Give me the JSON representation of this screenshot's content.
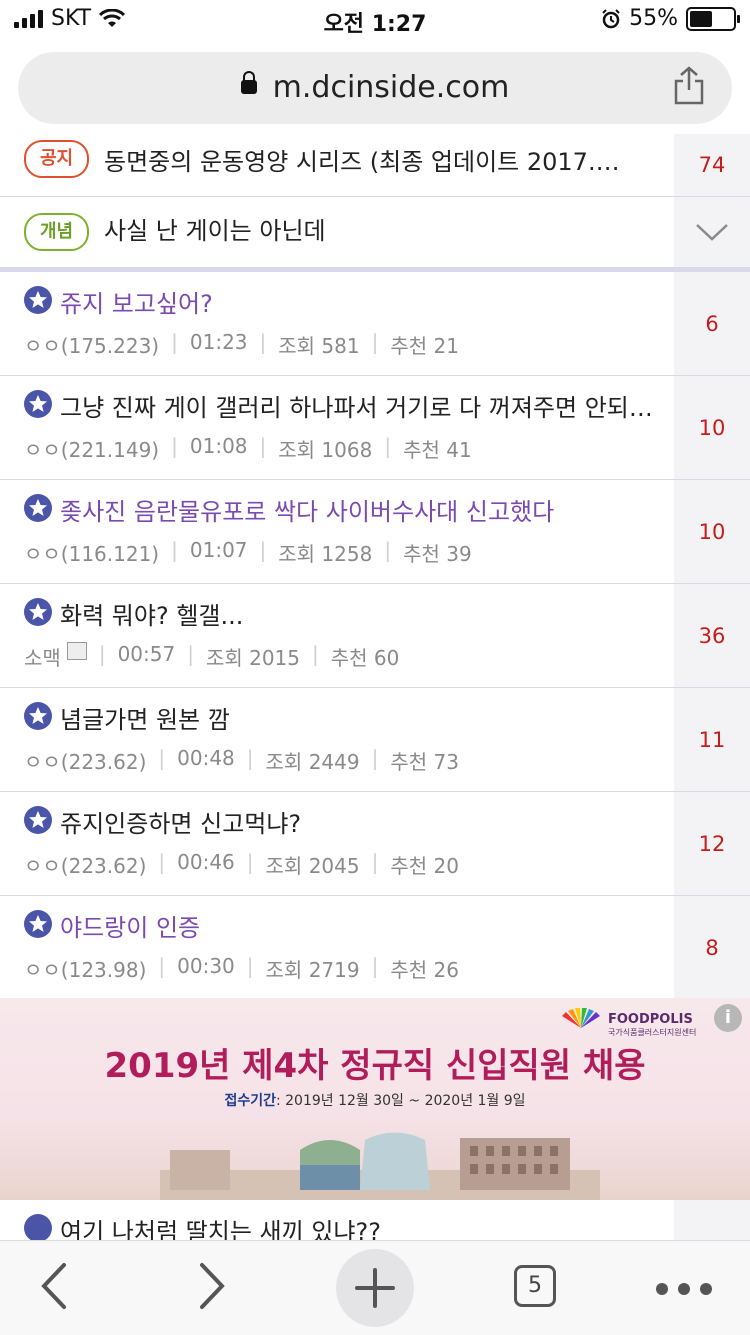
{
  "status_bar": {
    "carrier": "SKT",
    "time": "오전 1:27",
    "battery_pct": "55%",
    "battery_level": 0.55
  },
  "browser": {
    "url": "m.dcinside.com"
  },
  "pinned": [
    {
      "tag": "공지",
      "tag_color": "#e05030",
      "title": "동면중의 운동영양 시리즈 (최종 업데이트 2017.…",
      "count": "74"
    },
    {
      "tag": "개념",
      "tag_color": "#6d9e25",
      "title": "사실 난 게이는 아닌데"
    }
  ],
  "posts": [
    {
      "title": "쥬지 보고싶어?",
      "visited": true,
      "author": "ㅇㅇ(175.223)",
      "time": "01:23",
      "views": "조회 581",
      "recommend": "추천 21",
      "count": "6"
    },
    {
      "title": "그냥 진짜 게이 갤러리 하나파서 거기로 다 꺼져주면 안되…",
      "visited": false,
      "author": "ㅇㅇ(221.149)",
      "time": "01:08",
      "views": "조회 1068",
      "recommend": "추천 41",
      "count": "10"
    },
    {
      "title": "좆사진 음란물유포로 싹다 사이버수사대 신고했다",
      "visited": true,
      "author": "ㅇㅇ(116.121)",
      "time": "01:07",
      "views": "조회 1258",
      "recommend": "추천 39",
      "count": "10"
    },
    {
      "title": "화력 뭐야? 헬갤...",
      "visited": false,
      "author": "소맥",
      "time": "00:57",
      "views": "조회 2015",
      "recommend": "추천 60",
      "count": "36"
    },
    {
      "title": "념글가면 원본 깜",
      "visited": false,
      "author": "ㅇㅇ(223.62)",
      "time": "00:48",
      "views": "조회 2449",
      "recommend": "추천 73",
      "count": "11"
    },
    {
      "title": "쥬지인증하면 신고먹냐?",
      "visited": false,
      "author": "ㅇㅇ(223.62)",
      "time": "00:46",
      "views": "조회 2045",
      "recommend": "추천 20",
      "count": "12"
    },
    {
      "title": "야드랑이 인증",
      "visited": true,
      "author": "ㅇㅇ(123.98)",
      "time": "00:30",
      "views": "조회 2719",
      "recommend": "추천 26",
      "count": "8"
    }
  ],
  "ad": {
    "brand": "FOODPOLIS",
    "brand_sub": "국가식품클러스터지원센터",
    "headline": "2019년 제4차 정규직 신입직원 채용",
    "period_label": "접수기간",
    "period": ": 2019년 12월 30일 ~ 2020년 1월 9일",
    "info": "i"
  },
  "partial_post": {
    "title": "여기 나처럼 딸치는 새끼 있냐??"
  },
  "toolbar": {
    "tabs_count": "5"
  }
}
